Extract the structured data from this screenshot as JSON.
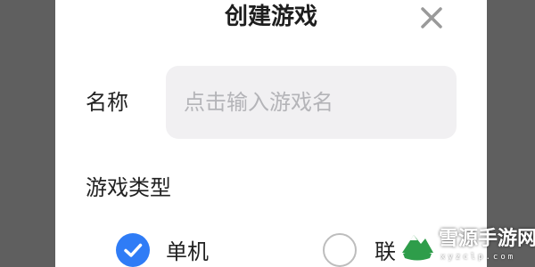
{
  "dialog": {
    "title": "创建游戏",
    "close_icon": "close-icon"
  },
  "form": {
    "name_label": "名称",
    "name_value": "",
    "name_placeholder": "点击输入游戏名",
    "type_label": "游戏类型",
    "type_options": [
      {
        "label": "单机",
        "checked": true
      },
      {
        "label": "联",
        "checked": false
      }
    ]
  },
  "watermark": {
    "brand": "雪源手游网",
    "url": "xyzclp.com"
  },
  "colors": {
    "accent": "#2f7cf6",
    "input_bg": "#f1f0f2",
    "overlay": "#5f5f5f"
  }
}
